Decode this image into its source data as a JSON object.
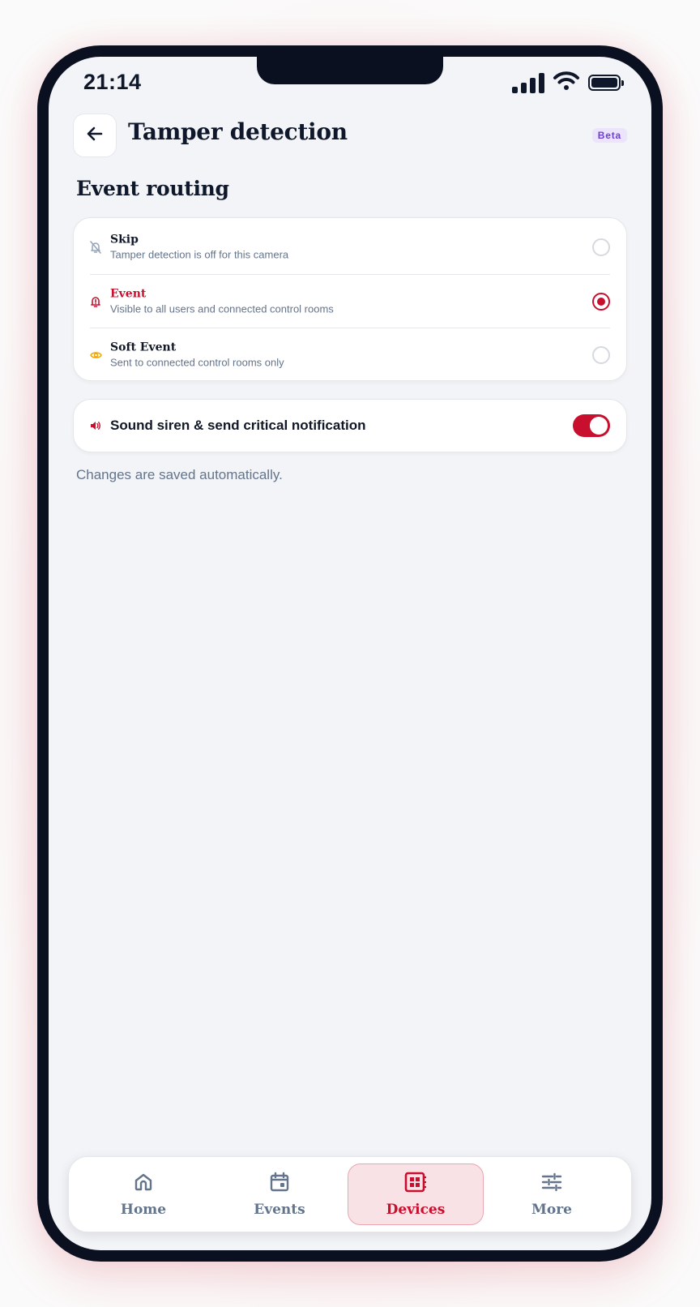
{
  "status_bar": {
    "time": "21:14",
    "icons": [
      "signal-icon",
      "wifi-icon",
      "battery-icon"
    ]
  },
  "header": {
    "title": "Tamper detection",
    "badge": "Beta",
    "back_icon": "arrow-left-icon"
  },
  "routing": {
    "section_title": "Event routing",
    "selected": "event",
    "options": [
      {
        "id": "skip",
        "title": "Skip",
        "description": "Tamper detection is off for this camera",
        "icon": "bell-off-icon",
        "selected": false
      },
      {
        "id": "event",
        "title": "Event",
        "description": "Visible to all users and connected control rooms",
        "icon": "bell-alert-icon",
        "selected": true
      },
      {
        "id": "soft-event",
        "title": "Soft Event",
        "description": "Sent to connected control rooms only",
        "icon": "eye-icon",
        "selected": false
      }
    ]
  },
  "siren": {
    "label": "Sound siren & send critical notification",
    "enabled": true,
    "icon": "speaker-icon"
  },
  "footer_note": "Changes are saved automatically.",
  "tabbar": {
    "active": "devices",
    "tabs": [
      {
        "id": "home",
        "label": "Home",
        "icon": "home-icon"
      },
      {
        "id": "events",
        "label": "Events",
        "icon": "calendar-icon"
      },
      {
        "id": "devices",
        "label": "Devices",
        "icon": "devices-icon"
      },
      {
        "id": "more",
        "label": "More",
        "icon": "sliders-icon"
      }
    ]
  },
  "colors": {
    "accent": "#c8102e",
    "text_primary": "#0f172a",
    "text_muted": "#64748b",
    "soft_event": "#f0a500",
    "badge_bg": "#ece4fb",
    "badge_text": "#6d3fd1",
    "screen_bg": "#f3f4f7"
  }
}
